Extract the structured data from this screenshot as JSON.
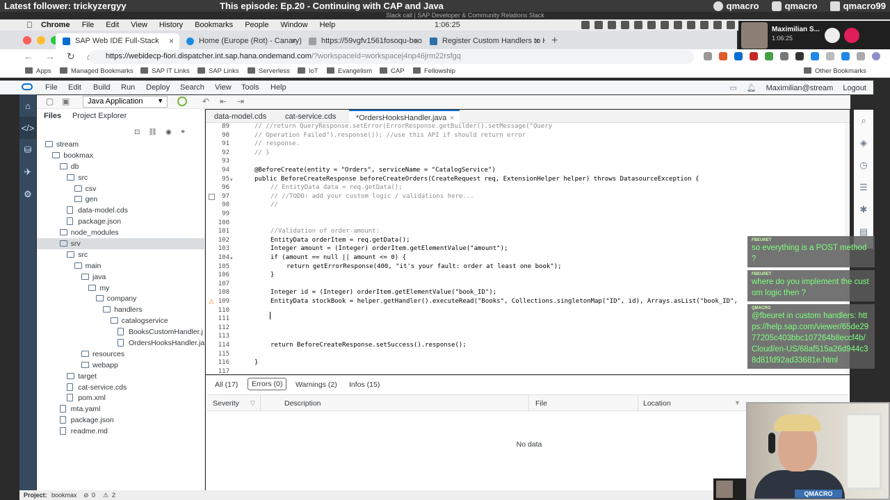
{
  "banner": {
    "follower": "Latest follower: trickyzergyy",
    "episode": "This episode: Ep.20 - Continuing with CAP and Java",
    "github": "qmacro",
    "twitter": "qmacro",
    "twitch": "qmacro99"
  },
  "slack_caption": "Slack call | SAP Developer & Community Relations Slack",
  "menubar": {
    "items": [
      "Chrome",
      "File",
      "Edit",
      "View",
      "History",
      "Bookmarks",
      "People",
      "Window",
      "Help"
    ],
    "clock": "1:06:25"
  },
  "call": {
    "name": "Maximilian S...",
    "time": "1:06:25"
  },
  "tabs": [
    {
      "label": "SAP Web IDE Full-Stack",
      "color": "#0a6ed1"
    },
    {
      "label": "Home (Europe (Rot) - Canary)",
      "color": "#1b8be0"
    },
    {
      "label": "https://59vgfv1561fosoqu-boo",
      "color": "#9e9e9e"
    },
    {
      "label": "Register Custom Handlers to H",
      "color": "#2f6fa8"
    }
  ],
  "address": {
    "host": "https://webidecp-fiori.dispatcher.int.sap.hana.ondemand.com",
    "query": "/?workspaceId=workspacej4np46jrm22rsfgq"
  },
  "bookmarks": [
    "Apps",
    "Managed Bookmarks",
    "SAP IT Links",
    "SAP Links",
    "Serverless",
    "IoT",
    "Evangelism",
    "CAP",
    "Fellowship",
    "Other Bookmarks"
  ],
  "ide_menu": {
    "items": [
      "File",
      "Edit",
      "Build",
      "Run",
      "Deploy",
      "Search",
      "View",
      "Tools",
      "Help"
    ],
    "user": "Maximilian@stream",
    "logout": "Logout"
  },
  "toolbar": {
    "run_config": "Java Application"
  },
  "explorer": {
    "tabs": [
      "Files",
      "Project Explorer"
    ],
    "tree": [
      {
        "label": "stream",
        "depth": 0,
        "type": "folder"
      },
      {
        "label": "bookmax",
        "depth": 1,
        "type": "folder"
      },
      {
        "label": "db",
        "depth": 2,
        "type": "folder"
      },
      {
        "label": "src",
        "depth": 3,
        "type": "folder"
      },
      {
        "label": "csv",
        "depth": 4,
        "type": "folder"
      },
      {
        "label": "gen",
        "depth": 4,
        "type": "folder"
      },
      {
        "label": "data-model.cds",
        "depth": 3,
        "type": "file"
      },
      {
        "label": "package.json",
        "depth": 3,
        "type": "file"
      },
      {
        "label": "node_modules",
        "depth": 2,
        "type": "folder"
      },
      {
        "label": "srv",
        "depth": 2,
        "type": "folder",
        "selected": true
      },
      {
        "label": "src",
        "depth": 3,
        "type": "folder"
      },
      {
        "label": "main",
        "depth": 4,
        "type": "folder"
      },
      {
        "label": "java",
        "depth": 5,
        "type": "folder"
      },
      {
        "label": "my",
        "depth": 6,
        "type": "folder"
      },
      {
        "label": "company",
        "depth": 7,
        "type": "folder"
      },
      {
        "label": "handlers",
        "depth": 8,
        "type": "folder"
      },
      {
        "label": "catalogservice",
        "depth": 9,
        "type": "folder"
      },
      {
        "label": "BooksCustomHandler.j",
        "depth": 10,
        "type": "file"
      },
      {
        "label": "OrdersHooksHandler.ja",
        "depth": 10,
        "type": "file"
      },
      {
        "label": "resources",
        "depth": 5,
        "type": "folder"
      },
      {
        "label": "webapp",
        "depth": 5,
        "type": "folder"
      },
      {
        "label": "target",
        "depth": 3,
        "type": "folder"
      },
      {
        "label": "cat-service.cds",
        "depth": 3,
        "type": "file"
      },
      {
        "label": "pom.xml",
        "depth": 3,
        "type": "file"
      },
      {
        "label": "mta.yaml",
        "depth": 2,
        "type": "file"
      },
      {
        "label": "package.json",
        "depth": 2,
        "type": "file"
      },
      {
        "label": "readme.md",
        "depth": 2,
        "type": "file"
      }
    ]
  },
  "editor_tabs": [
    {
      "label": "data-model.cds",
      "active": false
    },
    {
      "label": "cat-service.cds",
      "active": false
    },
    {
      "label": "*OrdersHooksHandler.java",
      "active": true
    }
  ],
  "code": [
    {
      "n": "89",
      "t": "// //return QueryResponse.setError(ErrorResponse.getBuilder().setMessage(\"Query",
      "c": true,
      "i": 0
    },
    {
      "n": "90",
      "t": "// Operation Failed\").response()); //use this API if should return error",
      "c": true,
      "i": 0
    },
    {
      "n": "91",
      "t": "// response.",
      "c": true,
      "i": 0
    },
    {
      "n": "92",
      "t": "// }",
      "c": true,
      "i": 0
    },
    {
      "n": "93",
      "t": "",
      "c": false,
      "i": 0
    },
    {
      "n": "94",
      "t": "@BeforeCreate(entity = \"Orders\", serviceName = \"CatalogService\")",
      "c": false,
      "i": 0
    },
    {
      "n": "95",
      "t": "public BeforeCreateResponse beforeCreateOrders(CreateRequest req, ExtensionHelper helper) throws DatasourceException {",
      "c": false,
      "i": 0
    },
    {
      "n": "96",
      "t": "// EntityData data = req.getData();",
      "c": true,
      "i": 1
    },
    {
      "n": "97",
      "t": "// //TODO: add your custom logic / validations here...",
      "c": true,
      "i": 1
    },
    {
      "n": "98",
      "t": "//",
      "c": true,
      "i": 1
    },
    {
      "n": "99",
      "t": "",
      "c": false,
      "i": 0
    },
    {
      "n": "100",
      "t": "",
      "c": false,
      "i": 0
    },
    {
      "n": "101",
      "t": "//Validation of order-amount:",
      "c": true,
      "i": 1
    },
    {
      "n": "102",
      "t": "EntityData orderItem = req.getData();",
      "c": false,
      "i": 1
    },
    {
      "n": "103",
      "t": "Integer amount = (Integer) orderItem.getElementValue(\"amount\");",
      "c": false,
      "i": 1
    },
    {
      "n": "104",
      "t": "if (amount == null || amount <= 0) {",
      "c": false,
      "i": 1
    },
    {
      "n": "105",
      "t": "return getErrorResponse(400, \"it's your fault: order at least one book\");",
      "c": false,
      "i": 2
    },
    {
      "n": "106",
      "t": "}",
      "c": false,
      "i": 1
    },
    {
      "n": "107",
      "t": "",
      "c": false,
      "i": 0
    },
    {
      "n": "108",
      "t": "Integer id = (Integer) orderItem.getElementValue(\"book_ID\");",
      "c": false,
      "i": 1
    },
    {
      "n": "109",
      "t": "EntityData stockBook = helper.getHandler().executeRead(\"Books\", Collections.singletonMap(\"ID\", id), Arrays.asList(\"book_ID\",",
      "c": false,
      "i": 1
    },
    {
      "n": "110",
      "t": "",
      "c": false,
      "i": 0
    },
    {
      "n": "111",
      "t": "",
      "c": false,
      "i": 0
    },
    {
      "n": "112",
      "t": "",
      "c": false,
      "i": 0
    },
    {
      "n": "113",
      "t": "",
      "c": false,
      "i": 0
    },
    {
      "n": "114",
      "t": "return BeforeCreateResponse.setSuccess().response();",
      "c": false,
      "i": 1
    },
    {
      "n": "115",
      "t": "",
      "c": false,
      "i": 0
    },
    {
      "n": "116",
      "t": "}",
      "c": false,
      "i": 0
    },
    {
      "n": "117",
      "t": "",
      "c": false,
      "i": 0
    }
  ],
  "problems": {
    "tabs": [
      "All (17)",
      "Errors (0)",
      "Warnings (2)",
      "Infos (15)"
    ],
    "columns": [
      "Severity",
      "Description",
      "File",
      "Location"
    ],
    "empty": "No data"
  },
  "status": {
    "project_label": "Project:",
    "project": "bookmax",
    "errors": "0",
    "warnings": "2"
  },
  "chat": [
    {
      "user": "FBEURET",
      "text": "so everything is a POST method ?"
    },
    {
      "user": "FBEURET",
      "text": "where do you implement the custom logic then ?"
    },
    {
      "user": "QMACRO",
      "text": "@fbeuret in custom handlers: https://help.sap.com/viewer/65de2977205c403bbc107264b8eccf4b/Cloud/en-US/68af515a26d944c38d81fd92ad33681e.html"
    }
  ],
  "webcam_tag": "QMACRO"
}
